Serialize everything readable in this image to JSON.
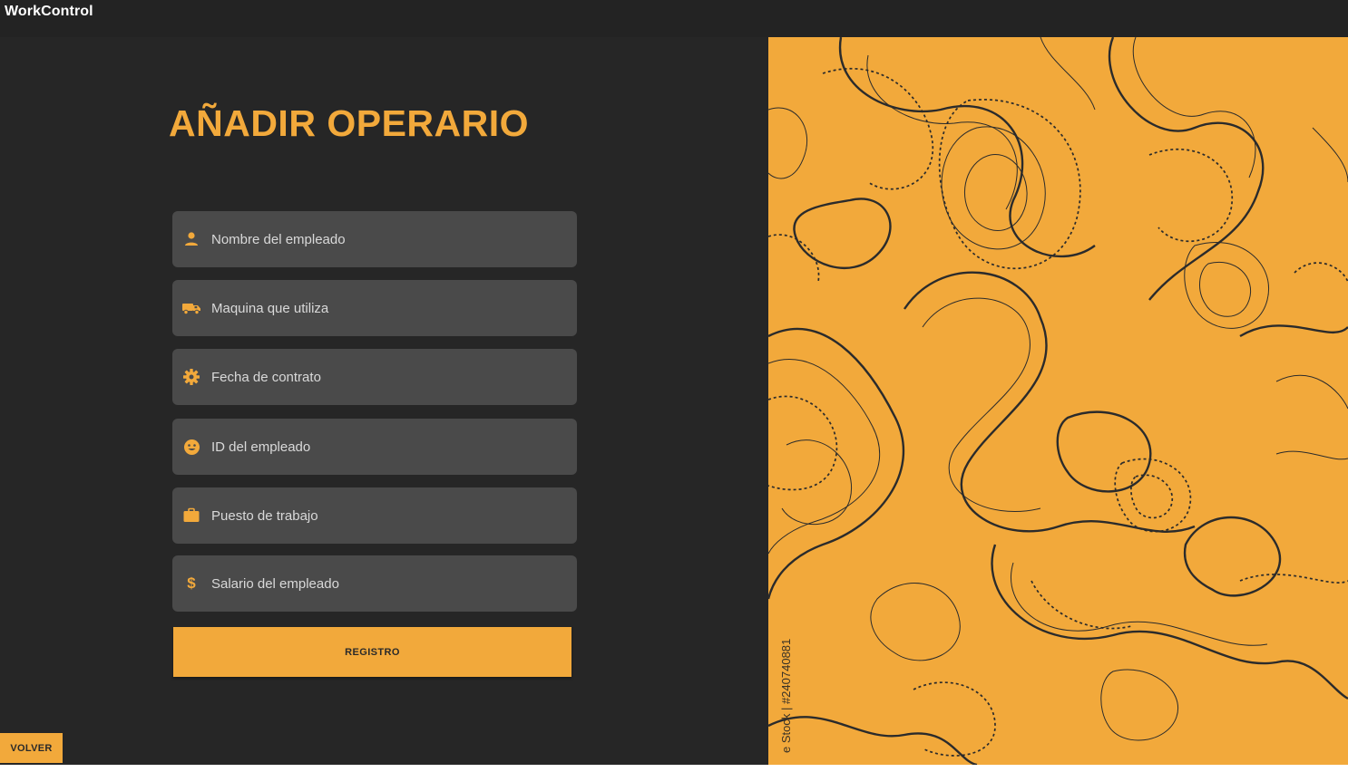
{
  "window": {
    "title": "WorkControl"
  },
  "form": {
    "title": "AÑADIR OPERARIO",
    "fields": [
      {
        "icon": "person-icon",
        "placeholder": "Nombre del empleado"
      },
      {
        "icon": "truck-icon",
        "placeholder": "Maquina que utiliza"
      },
      {
        "icon": "gear-icon",
        "placeholder": "Fecha de contrato"
      },
      {
        "icon": "smiley-icon",
        "placeholder": "ID del empleado"
      },
      {
        "icon": "briefcase-icon",
        "placeholder": "Puesto de trabajo"
      },
      {
        "icon": "dollar-icon",
        "placeholder": "Salario del empleado"
      }
    ],
    "submit_label": "REGISTRO"
  },
  "footer": {
    "back_label": "VOLVER"
  },
  "decor": {
    "watermark": "e Stock | #240740881"
  },
  "colors": {
    "accent": "#f2a93b",
    "background": "#262626",
    "field": "#4a4a4a",
    "line": "#2b2b2b"
  }
}
